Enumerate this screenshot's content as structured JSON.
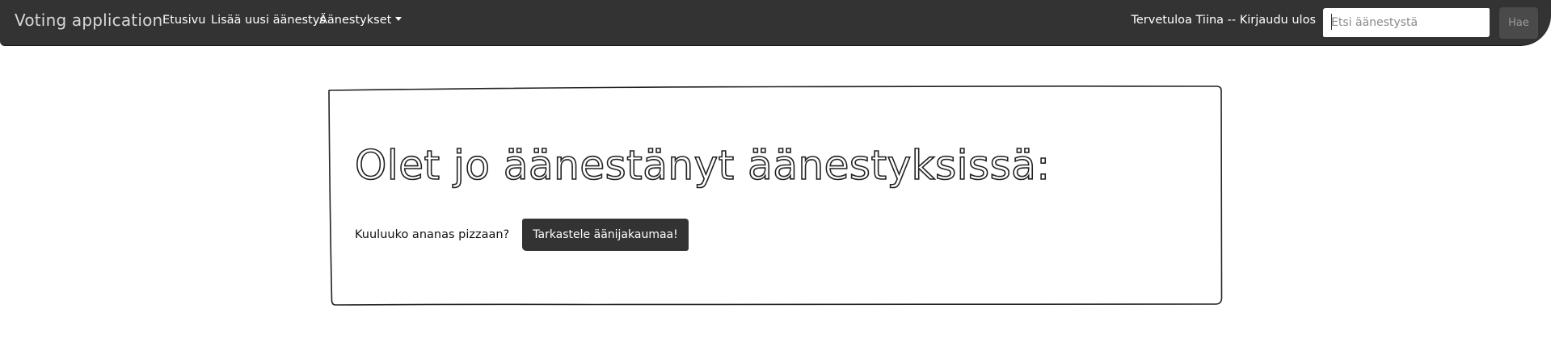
{
  "navbar": {
    "brand": "Voting application",
    "links": {
      "home": "Etusivu",
      "add_poll": "Lisää uusi äänestys",
      "polls_dropdown": "Äänestykset"
    },
    "welcome_text": "Tervetuloa Tiina -- ",
    "logout_link": "Kirjaudu ulos",
    "search": {
      "placeholder": "Etsi äänestystä",
      "button_label": "Hae"
    }
  },
  "main": {
    "heading": "Olet jo äänestänyt äänestyksissä:",
    "polls": [
      {
        "question": "Kuuluuko ananas pizzaan?",
        "button_label": "Tarkastele äänijakaumaa!"
      }
    ]
  },
  "colors": {
    "navbar_bg": "#333333",
    "button_bg": "#333333",
    "text": "#111111"
  }
}
